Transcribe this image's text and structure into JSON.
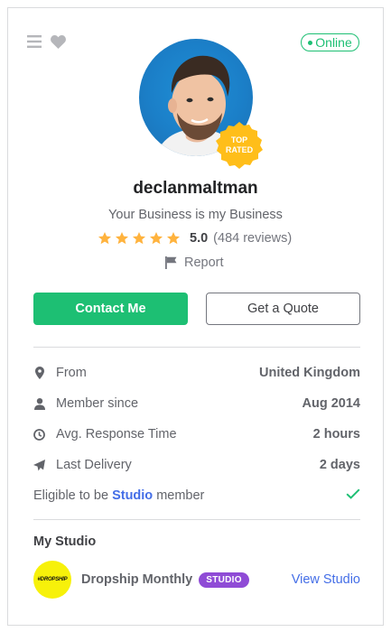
{
  "header": {
    "status_label": "Online"
  },
  "profile": {
    "username": "declanmaltman",
    "tagline": "Your Business is my Business",
    "badge_line1": "TOP",
    "badge_line2": "RATED",
    "rating": {
      "score": "5.0",
      "count": "(484 reviews)",
      "stars": 5
    },
    "report_label": "Report"
  },
  "actions": {
    "contact_label": "Contact Me",
    "quote_label": "Get a Quote"
  },
  "stats": [
    {
      "icon": "location-pin-icon",
      "label": "From",
      "value": "United Kingdom"
    },
    {
      "icon": "user-icon",
      "label": "Member since",
      "value": "Aug 2014"
    },
    {
      "icon": "clock-icon",
      "label": "Avg. Response Time",
      "value": "2 hours"
    },
    {
      "icon": "paper-plane-icon",
      "label": "Last Delivery",
      "value": "2 days"
    }
  ],
  "eligibility": {
    "prefix": "Eligible to be",
    "link": "Studio",
    "suffix": "member"
  },
  "studio": {
    "title": "My Studio",
    "logo_text": "#DROPSHIP",
    "name": "Dropship Monthly",
    "badge": "STUDIO",
    "link_label": "View Studio"
  },
  "colors": {
    "brand_green": "#1dbf73",
    "link_blue": "#446ee7",
    "star_gold": "#ffb33e",
    "studio_purple": "#8f4bd6"
  }
}
